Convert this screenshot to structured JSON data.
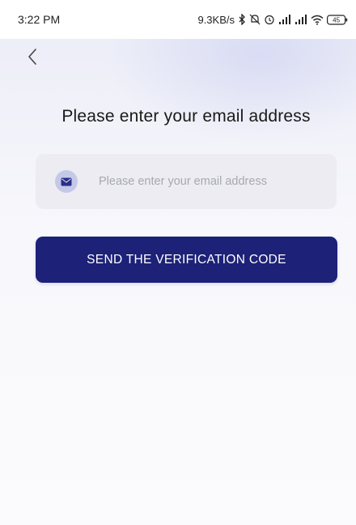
{
  "status_bar": {
    "time": "3:22 PM",
    "network_speed": "9.3KB/s",
    "battery_level": "45",
    "icons": [
      "bluetooth-icon",
      "mute-icon",
      "alarm-icon",
      "signal-icon",
      "signal-icon",
      "wifi-icon",
      "battery-icon"
    ]
  },
  "header": {
    "back_icon": "chevron-left-icon"
  },
  "main": {
    "title": "Please enter your email address",
    "email_field": {
      "value": "",
      "placeholder": "Please enter your email address",
      "icon": "mail-icon"
    },
    "send_button_label": "SEND THE VERIFICATION CODE"
  },
  "colors": {
    "primary": "#1d2178",
    "field_background": "#ececf2",
    "icon_circle": "#c5c9e8"
  }
}
